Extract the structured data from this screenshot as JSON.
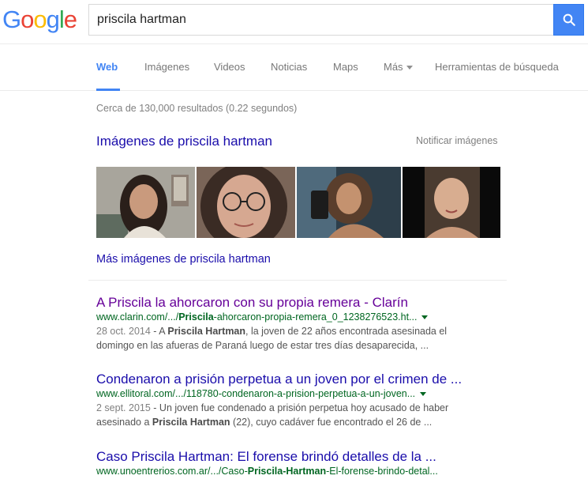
{
  "search": {
    "query": "priscila hartman"
  },
  "logo": {
    "letters": [
      "G",
      "o",
      "o",
      "g",
      "l",
      "e"
    ],
    "colors": [
      "#4285f4",
      "#ea4335",
      "#fbbc05",
      "#4285f4",
      "#34a853",
      "#ea4335"
    ]
  },
  "nav": {
    "tabs": [
      "Web",
      "Imágenes",
      "Videos",
      "Noticias",
      "Maps",
      "Más",
      "Herramientas de búsqueda"
    ]
  },
  "stats": "Cerca de 130,000 resultados (0.22 segundos)",
  "images": {
    "heading": "Imágenes de priscila hartman",
    "notify": "Notificar imágenes",
    "more": "Más imágenes de priscila hartman"
  },
  "results": [
    {
      "title": "A Priscila la ahorcaron con su propia remera - Clarín",
      "url_pre": "www.clarin.com/.../",
      "url_bold": "Priscila",
      "url_post": "-ahorcaron-propia-remera_0_1238276523.ht...",
      "date": "28 oct. 2014",
      "snip_a": " - A ",
      "snip_b": "Priscila Hartman",
      "snip_c": ", la joven de 22 años encontrada asesinada el",
      "snip_line2": "domingo en las afueras de Paraná luego de estar tres días desaparecida, ..."
    },
    {
      "title": "Condenaron a prisión perpetua a un joven por el crimen de ...",
      "url_pre": "www.ellitoral.com/.../118780-condenaron-a-prision-perpetua-a-un-joven...",
      "url_bold": "",
      "url_post": "",
      "date": "2 sept. 2015",
      "snip_a": " - Un joven fue condenado a prisión perpetua hoy acusado de haber",
      "snip_b": "",
      "snip_c": "",
      "snip_line2_a": "asesinado a ",
      "snip_line2_b": "Priscila Hartman",
      "snip_line2_c": " (22), cuyo cadáver fue encontrado el 26 de ..."
    },
    {
      "title": "Caso Priscila Hartman: El forense brindó detalles de la ...",
      "url_pre": "www.unoentrerios.com.ar/.../Caso-",
      "url_bold": "Priscila-Hartman",
      "url_post": "-El-forense-brindo-detal..."
    }
  ]
}
